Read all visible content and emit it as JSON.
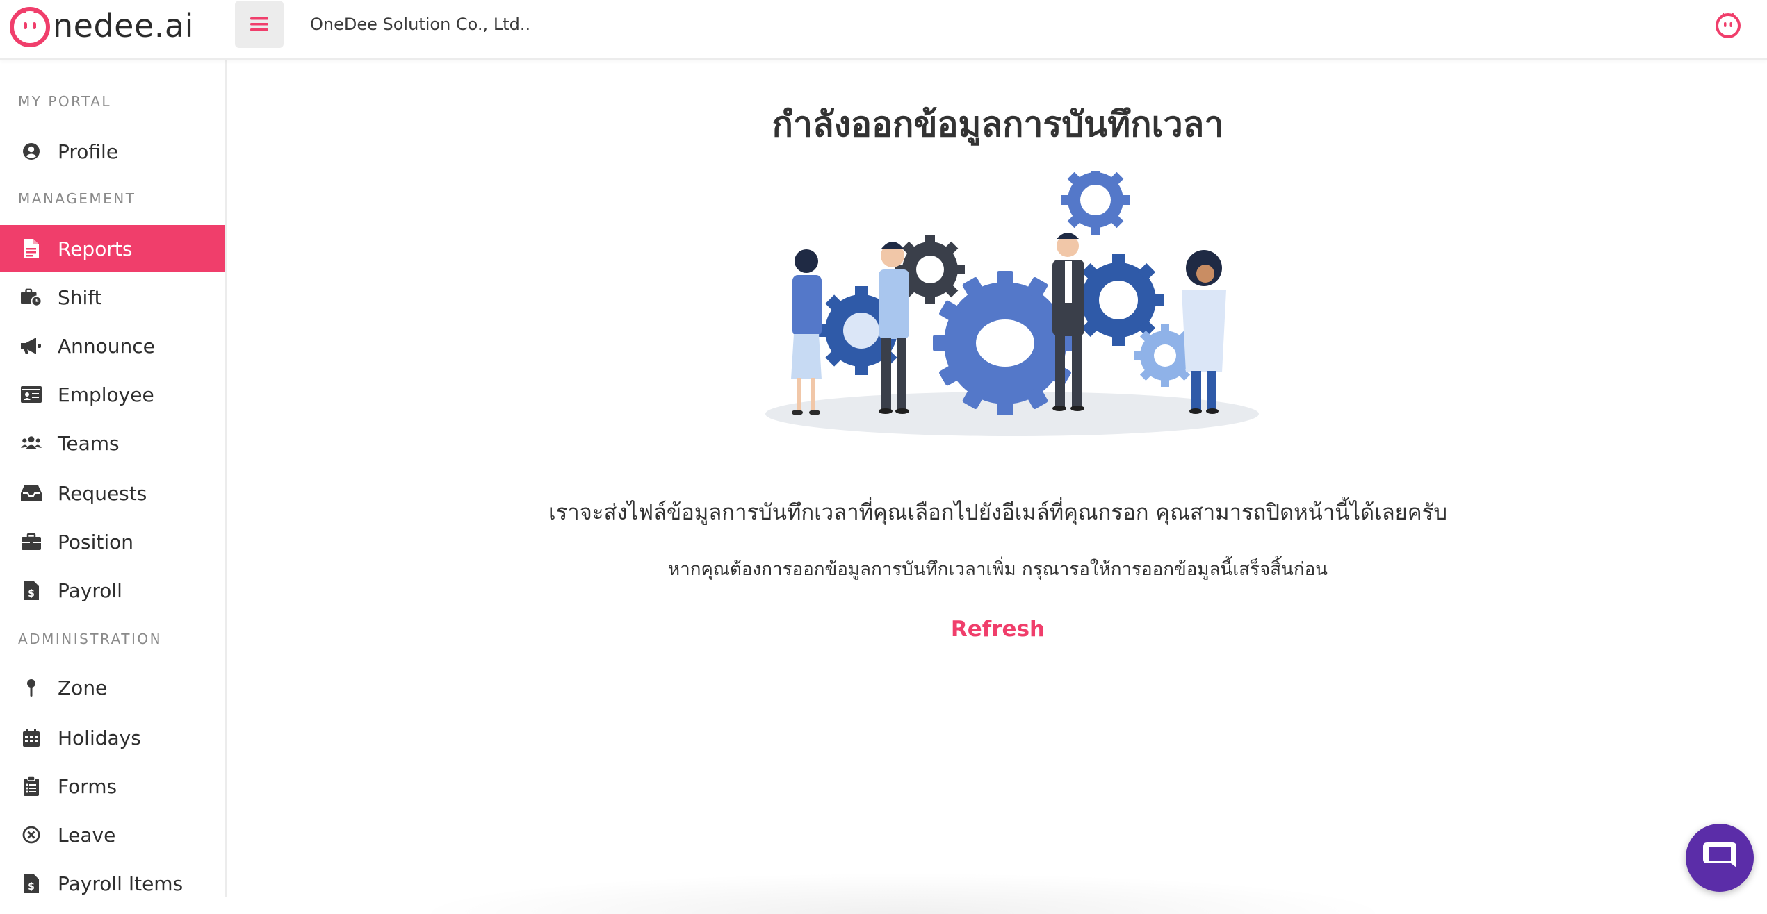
{
  "brand": {
    "logo_text": "nedee.ai",
    "accent_color": "#f03e6b"
  },
  "header": {
    "company_name": "OneDee Solution Co., Ltd.."
  },
  "sidebar": {
    "sections": {
      "my_portal": "MY PORTAL",
      "management": "MANAGEMENT",
      "administration": "ADMINISTRATION"
    },
    "items": [
      {
        "label": "Profile",
        "icon": "user-circle-icon"
      },
      {
        "label": "Reports",
        "icon": "file-report-icon",
        "active": true
      },
      {
        "label": "Shift",
        "icon": "briefcase-clock-icon"
      },
      {
        "label": "Announce",
        "icon": "megaphone-icon"
      },
      {
        "label": "Employee",
        "icon": "id-card-icon"
      },
      {
        "label": "Teams",
        "icon": "users-icon"
      },
      {
        "label": "Requests",
        "icon": "inbox-icon"
      },
      {
        "label": "Position",
        "icon": "briefcase-icon"
      },
      {
        "label": "Payroll",
        "icon": "file-invoice-dollar-icon"
      },
      {
        "label": "Zone",
        "icon": "map-pin-icon"
      },
      {
        "label": "Holidays",
        "icon": "calendar-icon"
      },
      {
        "label": "Forms",
        "icon": "clipboard-list-icon"
      },
      {
        "label": "Leave",
        "icon": "circle-x-icon"
      },
      {
        "label": "Payroll Items",
        "icon": "file-invoice-dollar-icon"
      }
    ]
  },
  "main": {
    "title": "กำลังออกข้อมูลการบันทึกเวลา",
    "message": "เราจะส่งไฟล์ข้อมูลการบันทึกเวลาที่คุณเลือกไปยังอีเมล์ที่คุณกรอก คุณสามารถปิดหน้านี้ได้เลยครับ",
    "submessage": "หากคุณต้องการออกข้อมูลการบันทึกเวลาเพิ่ม กรุณารอให้การออกข้อมูลนี้เสร็จสิ้นก่อน",
    "refresh_label": "Refresh"
  }
}
